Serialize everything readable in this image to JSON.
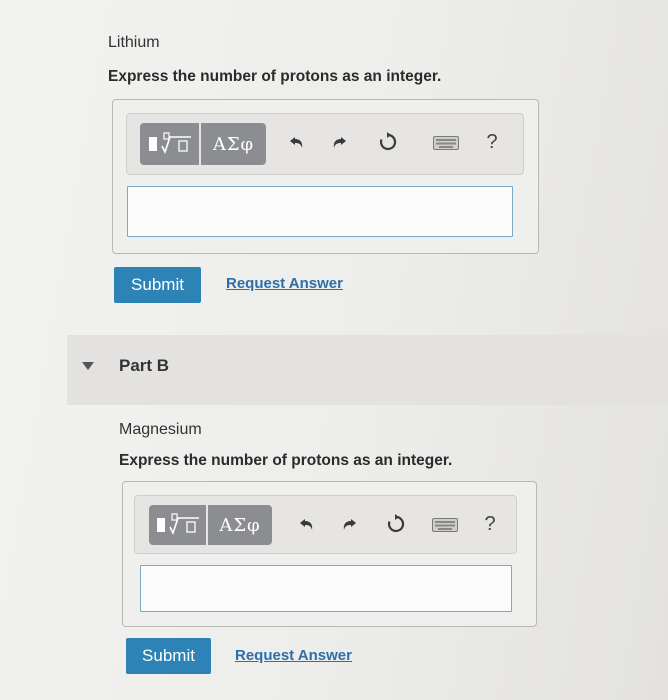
{
  "part_a": {
    "element_label": "Lithium",
    "prompt": "Express the number of protons as an integer.",
    "toolbar": {
      "templates_icon": "fraction-sqrt-template-icon",
      "greek_label": "ΑΣφ",
      "help_label": "?"
    },
    "answer_value": "",
    "submit_label": "Submit",
    "request_answer_label": "Request Answer"
  },
  "part_b": {
    "heading": "Part B",
    "element_label": "Magnesium",
    "prompt": "Express the number of protons as an integer.",
    "toolbar": {
      "templates_icon": "fraction-sqrt-template-icon",
      "greek_label": "ΑΣφ",
      "help_label": "?"
    },
    "answer_value": "",
    "submit_label": "Submit",
    "request_answer_label": "Request Answer"
  },
  "colors": {
    "submit": "#2e83b6",
    "link": "#2e6fa8",
    "toolbar_button": "#8c8d90",
    "input_border": "#7aa9c4"
  }
}
